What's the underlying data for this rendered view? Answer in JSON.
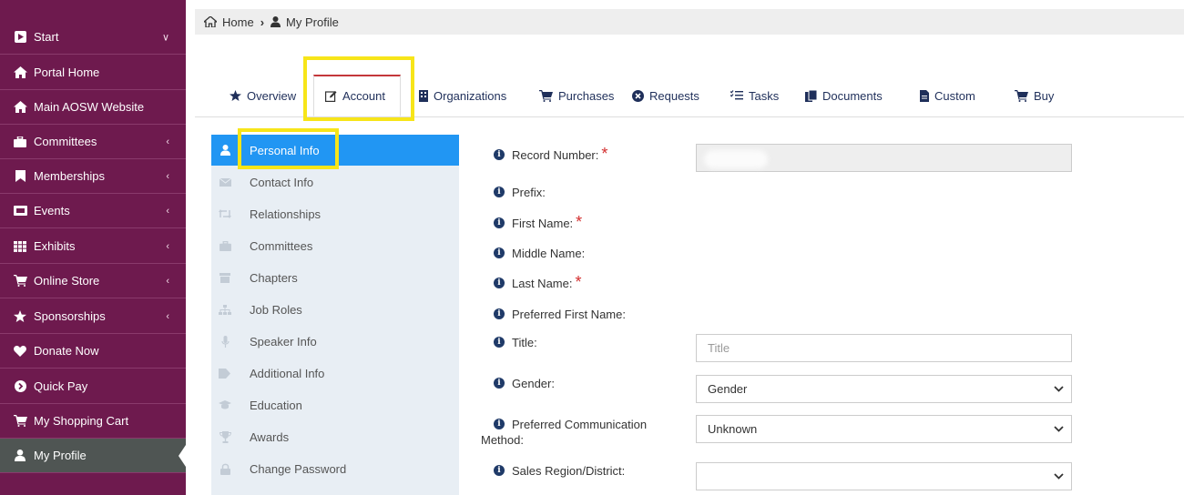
{
  "sidebar": {
    "items": [
      {
        "label": "Start",
        "icon": "play-square-icon",
        "chevron": "down"
      },
      {
        "label": "Portal Home",
        "icon": "home-icon",
        "chevron": ""
      },
      {
        "label": "Main AOSW Website",
        "icon": "home-icon",
        "chevron": ""
      },
      {
        "label": "Committees",
        "icon": "briefcase-icon",
        "chevron": "left"
      },
      {
        "label": "Memberships",
        "icon": "bookmark-icon",
        "chevron": "left"
      },
      {
        "label": "Events",
        "icon": "ticket-icon",
        "chevron": "left"
      },
      {
        "label": "Exhibits",
        "icon": "grid-icon",
        "chevron": "left"
      },
      {
        "label": "Online Store",
        "icon": "cart-icon",
        "chevron": "left"
      },
      {
        "label": "Sponsorships",
        "icon": "star-icon",
        "chevron": "left"
      },
      {
        "label": "Donate Now",
        "icon": "heart-icon",
        "chevron": ""
      },
      {
        "label": "Quick Pay",
        "icon": "arrow-circle-icon",
        "chevron": ""
      },
      {
        "label": "My Shopping Cart",
        "icon": "cart-icon",
        "chevron": ""
      },
      {
        "label": "My Profile",
        "icon": "user-icon",
        "chevron": "",
        "active": true
      }
    ]
  },
  "breadcrumb": {
    "home": "Home",
    "current": "My Profile"
  },
  "tabs": [
    {
      "label": "Overview",
      "icon": "star-icon"
    },
    {
      "label": "Account",
      "icon": "edit-icon",
      "active": true
    },
    {
      "label": "Organizations",
      "icon": "building-icon"
    },
    {
      "label": "Purchases",
      "icon": "cart-icon"
    },
    {
      "label": "Requests",
      "icon": "cross-circle-icon"
    },
    {
      "label": "Tasks",
      "icon": "tasks-icon"
    },
    {
      "label": "Documents",
      "icon": "documents-icon"
    },
    {
      "label": "Custom",
      "icon": "file-icon"
    },
    {
      "label": "Buy",
      "icon": "cart-icon"
    }
  ],
  "subnav": [
    {
      "label": "Personal Info",
      "icon": "user-icon",
      "active": true
    },
    {
      "label": "Contact Info",
      "icon": "envelope-icon"
    },
    {
      "label": "Relationships",
      "icon": "retweet-icon"
    },
    {
      "label": "Committees",
      "icon": "briefcase-icon"
    },
    {
      "label": "Chapters",
      "icon": "archive-icon"
    },
    {
      "label": "Job Roles",
      "icon": "sitemap-icon"
    },
    {
      "label": "Speaker Info",
      "icon": "microphone-icon"
    },
    {
      "label": "Additional Info",
      "icon": "tag-icon"
    },
    {
      "label": "Education",
      "icon": "graduation-cap-icon"
    },
    {
      "label": "Awards",
      "icon": "trophy-icon"
    },
    {
      "label": "Change Password",
      "icon": "lock-icon"
    }
  ],
  "form": {
    "record_number": {
      "label": "Record Number:"
    },
    "prefix": {
      "label": "Prefix:"
    },
    "first_name": {
      "label": "First Name:"
    },
    "middle_name": {
      "label": "Middle Name:"
    },
    "last_name": {
      "label": "Last Name:"
    },
    "preferred_first_name": {
      "label": "Preferred First Name:"
    },
    "title": {
      "label": "Title:",
      "placeholder": "Title"
    },
    "gender": {
      "label": "Gender:",
      "value": "Gender"
    },
    "preferred_comm": {
      "label_line1": "Preferred Communication",
      "label_line2": "Method:",
      "value": "Unknown"
    },
    "sales_region": {
      "label": "Sales Region/District:",
      "value": ""
    }
  },
  "colors": {
    "sidebar_bg": "#6e1a4e",
    "sidebar_active": "#4f5553",
    "accent_blue": "#2196f3",
    "highlight_yellow": "#f7e519",
    "required_red": "#d32f2f"
  }
}
